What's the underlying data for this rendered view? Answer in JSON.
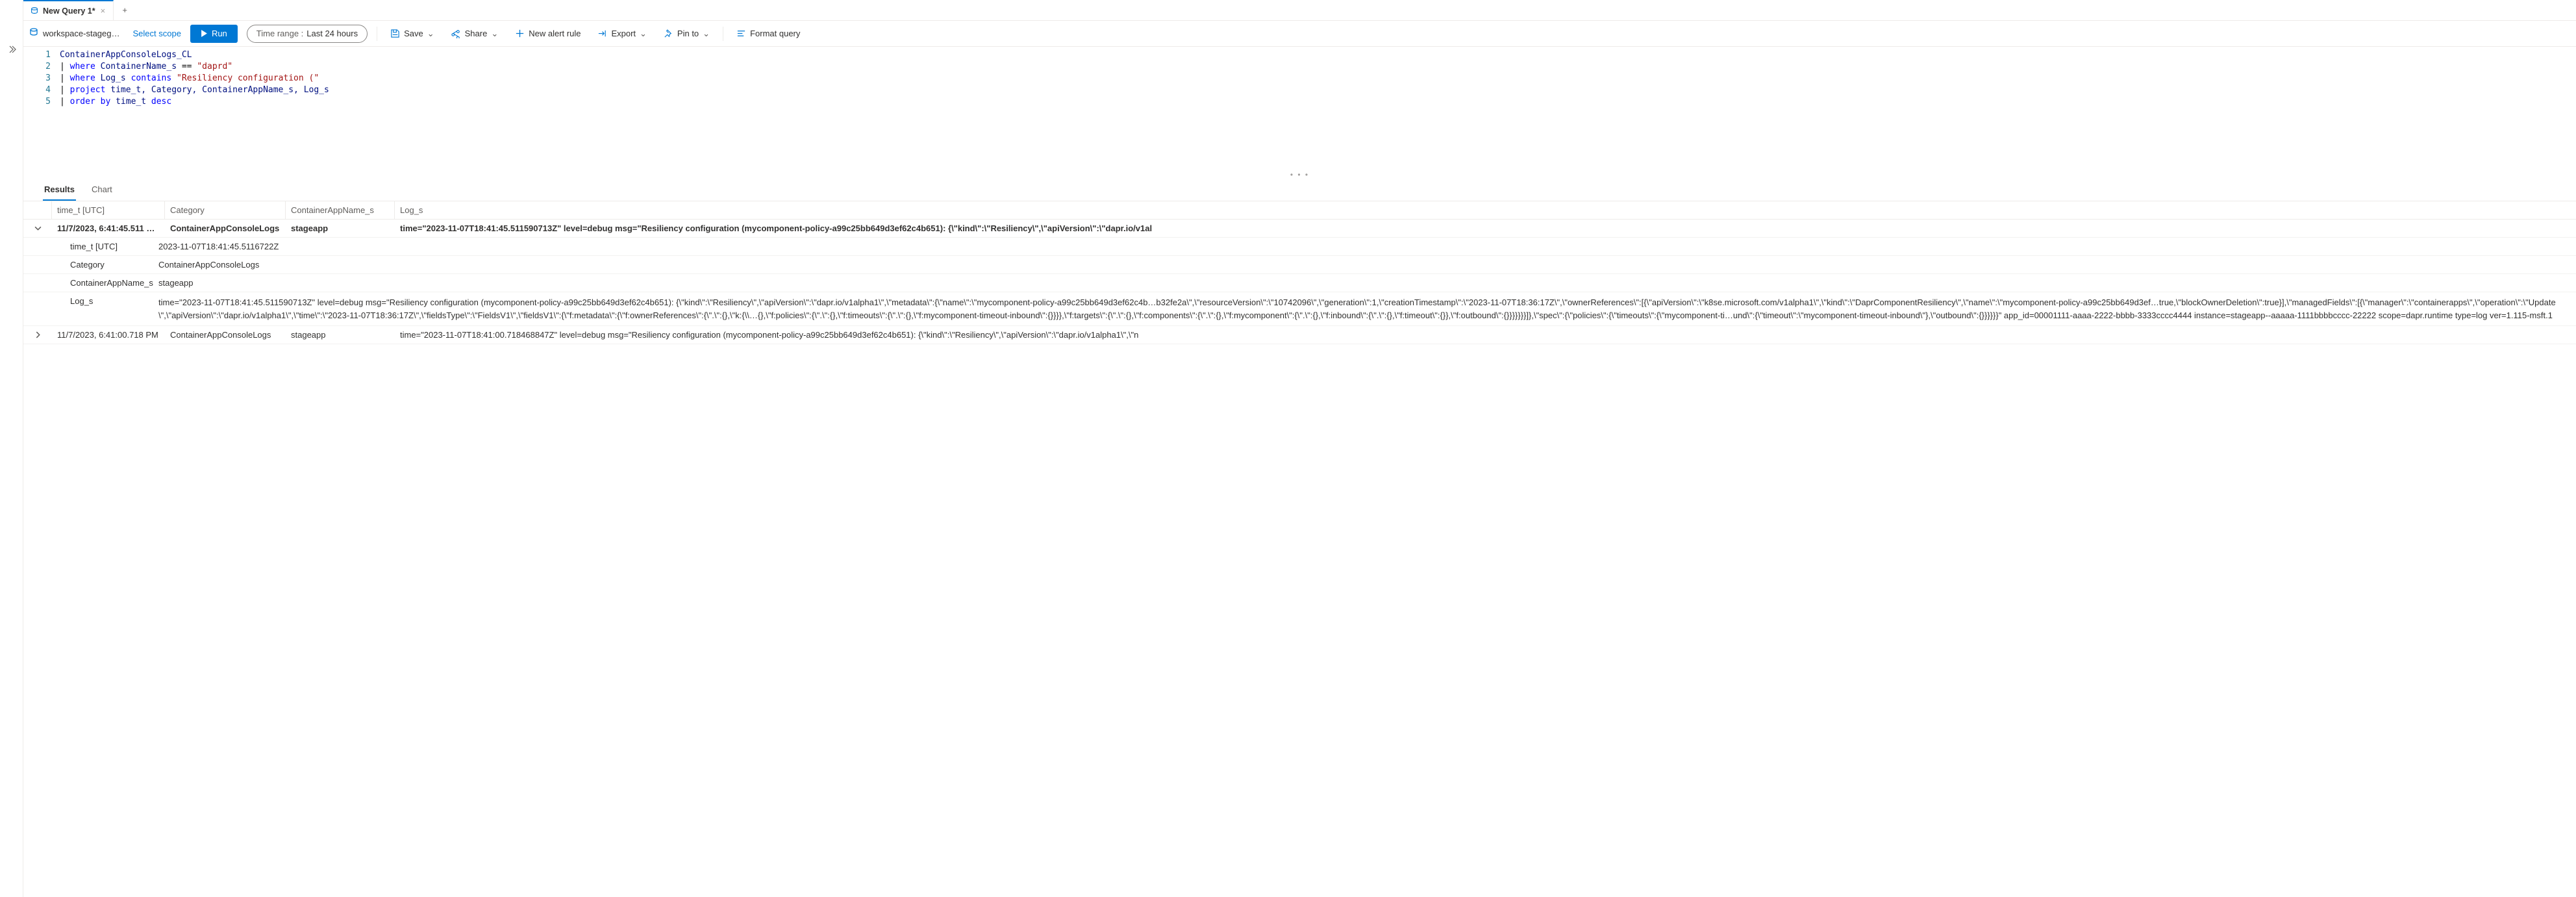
{
  "tabs": {
    "active_title": "New Query 1*",
    "close_glyph": "×",
    "add_glyph": "+"
  },
  "scope": {
    "workspace_name": "workspace-stageg…",
    "select_scope_label": "Select scope"
  },
  "toolbar": {
    "run_label": "Run",
    "time_range_label": "Time range :",
    "time_range_value": "Last 24 hours",
    "save_label": "Save",
    "share_label": "Share",
    "new_alert_label": "New alert rule",
    "export_label": "Export",
    "pin_label": "Pin to",
    "format_label": "Format query"
  },
  "editor": {
    "lines": [
      {
        "n": "1",
        "segments": [
          {
            "t": "ContainerAppConsoleLogs_CL",
            "c": "tbl"
          }
        ]
      },
      {
        "n": "2",
        "segments": [
          {
            "t": "| ",
            "c": "op"
          },
          {
            "t": "where",
            "c": "kw"
          },
          {
            "t": " ContainerName_s ",
            "c": "id"
          },
          {
            "t": "==",
            "c": "op"
          },
          {
            "t": " ",
            "c": "op"
          },
          {
            "t": "\"daprd\"",
            "c": "str"
          }
        ]
      },
      {
        "n": "3",
        "segments": [
          {
            "t": "| ",
            "c": "op"
          },
          {
            "t": "where",
            "c": "kw"
          },
          {
            "t": " Log_s ",
            "c": "id"
          },
          {
            "t": "contains",
            "c": "kw"
          },
          {
            "t": " ",
            "c": "op"
          },
          {
            "t": "\"Resiliency configuration (\"",
            "c": "str"
          }
        ]
      },
      {
        "n": "4",
        "segments": [
          {
            "t": "| ",
            "c": "op"
          },
          {
            "t": "project",
            "c": "kw"
          },
          {
            "t": " time_t, Category, ContainerAppName_s, Log_s",
            "c": "id"
          }
        ]
      },
      {
        "n": "5",
        "segments": [
          {
            "t": "| ",
            "c": "op"
          },
          {
            "t": "order by",
            "c": "kw"
          },
          {
            "t": " time_t ",
            "c": "id"
          },
          {
            "t": "desc",
            "c": "kw"
          }
        ]
      }
    ]
  },
  "results": {
    "tabs": {
      "results": "Results",
      "chart": "Chart"
    },
    "columns": {
      "time": "time_t [UTC]",
      "category": "Category",
      "app": "ContainerAppName_s",
      "log": "Log_s"
    },
    "rows": [
      {
        "expanded": true,
        "time": "11/7/2023, 6:41:45.511 …",
        "category": "ContainerAppConsoleLogs",
        "app": "stageapp",
        "log_preview": "time=\"2023-11-07T18:41:45.511590713Z\" level=debug msg=\"Resiliency configuration (mycomponent-policy-a99c25bb649d3ef62c4b651): {\\\"kind\\\":\\\"Resiliency\\\",\\\"apiVersion\\\":\\\"dapr.io/v1al",
        "details": {
          "time_t_key": "time_t [UTC]",
          "time_t_val": "2023-11-07T18:41:45.5116722Z",
          "category_key": "Category",
          "category_val": "ContainerAppConsoleLogs",
          "app_key": "ContainerAppName_s",
          "app_val": "stageapp",
          "log_key": "Log_s",
          "log_val": "time=\"2023-11-07T18:41:45.511590713Z\" level=debug msg=\"Resiliency configuration (mycomponent-policy-a99c25bb649d3ef62c4b651): {\\\"kind\\\":\\\"Resiliency\\\",\\\"apiVersion\\\":\\\"dapr.io/v1alpha1\\\",\\\"metadata\\\":{\\\"name\\\":\\\"mycomponent-policy-a99c25bb649d3ef62c4b…b32fe2a\\\",\\\"resourceVersion\\\":\\\"10742096\\\",\\\"generation\\\":1,\\\"creationTimestamp\\\":\\\"2023-11-07T18:36:17Z\\\",\\\"ownerReferences\\\":[{\\\"apiVersion\\\":\\\"k8se.microsoft.com/v1alpha1\\\",\\\"kind\\\":\\\"DaprComponentResiliency\\\",\\\"name\\\":\\\"mycomponent-policy-a99c25bb649d3ef…true,\\\"blockOwnerDeletion\\\":true}],\\\"managedFields\\\":[{\\\"manager\\\":\\\"containerapps\\\",\\\"operation\\\":\\\"Update\\\",\\\"apiVersion\\\":\\\"dapr.io/v1alpha1\\\",\\\"time\\\":\\\"2023-11-07T18:36:17Z\\\",\\\"fieldsType\\\":\\\"FieldsV1\\\",\\\"fieldsV1\\\":{\\\"f:metadata\\\":{\\\"f:ownerReferences\\\":{\\\".\\\":{},\\\"k:{\\\\…{},\\\"f:policies\\\":{\\\".\\\":{},\\\"f:timeouts\\\":{\\\".\\\":{},\\\"f:mycomponent-timeout-inbound\\\":{}}}},\\\"f:targets\\\":{\\\".\\\":{},\\\"f:components\\\":{\\\".\\\":{},\\\"f:mycomponent\\\":{\\\".\\\":{},\\\"f:inbound\\\":{\\\".\\\":{},\\\"f:timeout\\\":{}},\\\"f:outbound\\\":{}}}}}}}]},\\\"spec\\\":{\\\"policies\\\":{\\\"timeouts\\\":{\\\"mycomponent-ti…und\\\":{\\\"timeout\\\":\\\"mycomponent-timeout-inbound\\\"},\\\"outbound\\\":{}}}}}}\" app_id=00001111-aaaa-2222-bbbb-3333cccc4444 instance=stageapp--aaaaa-1111bbbbcccc-22222 scope=dapr.runtime type=log ver=1.115-msft.1"
        }
      },
      {
        "expanded": false,
        "time": "11/7/2023, 6:41:00.718 PM",
        "category": "ContainerAppConsoleLogs",
        "app": "stageapp",
        "log_preview": "time=\"2023-11-07T18:41:00.718468847Z\" level=debug msg=\"Resiliency configuration (mycomponent-policy-a99c25bb649d3ef62c4b651): {\\\"kind\\\":\\\"Resiliency\\\",\\\"apiVersion\\\":\\\"dapr.io/v1alpha1\\\",\\\"n"
      }
    ]
  },
  "glyphs": {
    "chev_down": "⌄",
    "chev_right": "›",
    "dots": "• • •"
  }
}
